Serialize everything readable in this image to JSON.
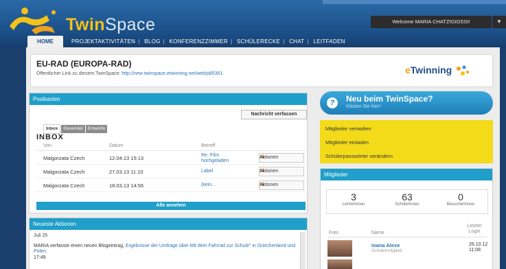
{
  "app": {
    "brand_twin": "Twin",
    "brand_space": "Space",
    "welcome": "Welcome MARIA CHATZIGIOSSI!",
    "menu_arrow": "▼"
  },
  "nav": {
    "home": "HOME",
    "items": [
      "PROJEKTAKTIVITÄTEN",
      "BLOG",
      "KONFERENZZIMMER",
      "SCHÜLERECKE",
      "CHAT",
      "LEITFADEN"
    ]
  },
  "project": {
    "title": "EU-RAD (EUROPA-RAD)",
    "public_link_label": "Öffentlicher Link zu diesem TwinSpace:",
    "public_link_url": "http://new-twinspace.etwinning.net/web/p85361",
    "etwinning_e": "e",
    "etwinning_rest": "Twinning"
  },
  "postkasten": {
    "header": "Postkasten",
    "compose_button": "Nachricht verfassen",
    "tabs": [
      "Inbox",
      "Gesendet",
      "Entwürfe"
    ],
    "inbox_title": "INBOX",
    "columns": [
      "Von",
      "Datum",
      "Betreff"
    ],
    "rows": [
      {
        "from": "Malgorzata Czech",
        "date": "12.04.13 15:13",
        "subject": "Re: Film hochgeladen",
        "action": "Aktionen"
      },
      {
        "from": "Malgorzata Czech",
        "date": "27.03.13 11:10",
        "subject": "Label",
        "action": "Aktionen"
      },
      {
        "from": "Malgorzata Czech",
        "date": "18.03.13 14:56",
        "subject": "(kein...",
        "action": "Aktionen"
      }
    ],
    "view_all": "Alle ansehen"
  },
  "aktionen": {
    "header": "Neueste Aktionen",
    "date": "Juli 25",
    "text": "MARIA verfasste einen neuen Blogeintrag,",
    "link": "Ergebnisse der Umfrage über Mit dem Fahrrad zur Schule\" in Griechenland und Polen.",
    "time": "17:49"
  },
  "neu": {
    "icon": "?",
    "title": "Neu beim TwinSpace?",
    "subtitle": "Klicken Sie hier!"
  },
  "links": [
    "Mitglieder verwalten",
    "Mitglieder einladen",
    "Schülerpasswörter verändern"
  ],
  "mitglieder": {
    "header": "Mitglieder",
    "stats": [
      {
        "value": "3",
        "label": "LehrerInnen"
      },
      {
        "value": "63",
        "label": "SchülerInnen"
      },
      {
        "value": "0",
        "label": "BesucherInnen"
      }
    ],
    "columns": [
      "Foto",
      "Name",
      "Letzter Login"
    ],
    "members": [
      {
        "name": "Ioana Alexe",
        "role": "Schülermitglied",
        "login_date": "26.10.12",
        "login_time": "11:08"
      }
    ]
  },
  "colors": {
    "accent": "#1f9fc9",
    "header": "#1b4f87",
    "yellow": "#f3db1a",
    "brand": "#f4c21a"
  }
}
